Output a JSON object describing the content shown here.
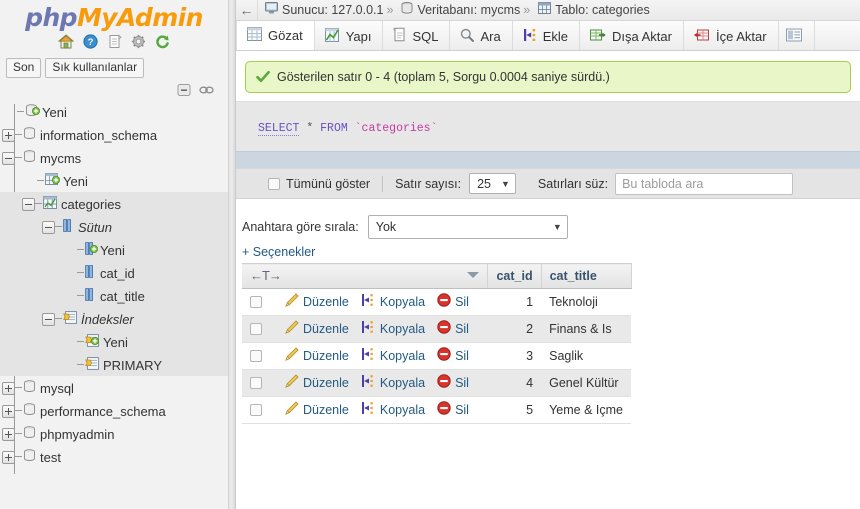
{
  "brand": {
    "php": "php",
    "myadmin": "MyAdmin"
  },
  "nav_icons": [
    {
      "name": "home-icon",
      "title": "Ana Sayfa"
    },
    {
      "name": "help-icon",
      "title": "Yardım"
    },
    {
      "name": "docs-icon",
      "title": "Belgeler"
    },
    {
      "name": "settings-gear-icon",
      "title": "Ayarlar"
    },
    {
      "name": "reload-icon",
      "title": "Yenile"
    }
  ],
  "nav_tabs": [
    {
      "label": "Son",
      "active": false
    },
    {
      "label": "Sık kullanılanlar",
      "active": false
    }
  ],
  "nav_collapse": [
    {
      "name": "collapse-all-icon"
    },
    {
      "name": "link-with-main-panel-icon"
    }
  ],
  "tree": [
    {
      "label": "Yeni",
      "depth": 1,
      "toggle": "none",
      "icon": "db-new-icon",
      "italic": false,
      "highlight": false
    },
    {
      "label": "information_schema",
      "depth": 1,
      "toggle": "plus",
      "icon": "db-icon",
      "italic": false,
      "highlight": false
    },
    {
      "label": "mycms",
      "depth": 1,
      "toggle": "minus",
      "icon": "db-icon",
      "italic": false,
      "highlight": false
    },
    {
      "label": "Yeni",
      "depth": 2,
      "toggle": "none",
      "icon": "table-new-icon",
      "italic": false,
      "highlight": false
    },
    {
      "label": "categories",
      "depth": 2,
      "toggle": "minus",
      "icon": "table-icon",
      "italic": false,
      "highlight": true
    },
    {
      "label": "Sütun",
      "depth": 3,
      "toggle": "minus",
      "icon": "columns-icon",
      "italic": true,
      "highlight": true
    },
    {
      "label": "Yeni",
      "depth": 4,
      "toggle": "none",
      "icon": "column-new-icon",
      "italic": false,
      "highlight": true
    },
    {
      "label": "cat_id",
      "depth": 4,
      "toggle": "none",
      "icon": "column-icon",
      "italic": false,
      "highlight": true
    },
    {
      "label": "cat_title",
      "depth": 4,
      "toggle": "none",
      "icon": "column-icon",
      "italic": false,
      "highlight": true
    },
    {
      "label": "İndeksler",
      "depth": 3,
      "toggle": "minus",
      "icon": "indexes-icon",
      "italic": true,
      "highlight": true
    },
    {
      "label": "Yeni",
      "depth": 4,
      "toggle": "none",
      "icon": "index-new-icon",
      "italic": false,
      "highlight": true
    },
    {
      "label": "PRIMARY",
      "depth": 4,
      "toggle": "none",
      "icon": "index-icon",
      "italic": false,
      "highlight": true
    },
    {
      "label": "mysql",
      "depth": 1,
      "toggle": "plus",
      "icon": "db-icon",
      "italic": false,
      "highlight": false
    },
    {
      "label": "performance_schema",
      "depth": 1,
      "toggle": "plus",
      "icon": "db-icon",
      "italic": false,
      "highlight": false
    },
    {
      "label": "phpmyadmin",
      "depth": 1,
      "toggle": "plus",
      "icon": "db-icon",
      "italic": false,
      "highlight": false
    },
    {
      "label": "test",
      "depth": 1,
      "toggle": "plus",
      "icon": "db-icon",
      "italic": false,
      "highlight": false
    }
  ],
  "breadcrumb": {
    "back_glyph": "←",
    "separator": "»",
    "segments": [
      {
        "label": "Sunucu: 127.0.0.1",
        "icon": "server-icon"
      },
      {
        "label": "Veritabanı: mycms",
        "icon": "database-icon"
      },
      {
        "label": "Tablo: categories",
        "icon": "table-icon"
      }
    ]
  },
  "tabs": [
    {
      "label": "Gözat",
      "icon": "browse-icon",
      "active": true
    },
    {
      "label": "Yapı",
      "icon": "structure-icon",
      "active": false
    },
    {
      "label": "SQL",
      "icon": "sql-icon",
      "active": false
    },
    {
      "label": "Ara",
      "icon": "search-icon",
      "active": false
    },
    {
      "label": "Ekle",
      "icon": "insert-icon",
      "active": false
    },
    {
      "label": "Dışa Aktar",
      "icon": "export-icon",
      "active": false
    },
    {
      "label": "İçe Aktar",
      "icon": "import-icon",
      "active": false
    },
    {
      "label": "",
      "icon": "privileges-icon",
      "active": false
    }
  ],
  "success": {
    "icon": "checkmark-icon",
    "message": "Gösterilen satır 0 - 4 (toplam 5, Sorgu 0.0004 saniye sürdü.)"
  },
  "sql": {
    "keyword_select": "SELECT",
    "star": "*",
    "keyword_from": "FROM",
    "identifier": "`categories`"
  },
  "options_row": {
    "show_all_label": "Tümünü göster",
    "row_count_label": "Satır sayısı:",
    "row_count_value": "25",
    "filter_label": "Satırları süz:",
    "filter_placeholder": "Bu tabloda ara",
    "filter_value": ""
  },
  "sort_row": {
    "label": "Anahtara göre sırala:",
    "value": "Yok"
  },
  "options_link": "+ Seçenekler",
  "table": {
    "action_header_arrows": "←T→",
    "columns": [
      "cat_id",
      "cat_title"
    ],
    "action_labels": {
      "edit": "Düzenle",
      "copy": "Kopyala",
      "delete": "Sil"
    },
    "rows": [
      {
        "cat_id": "1",
        "cat_title": "Teknoloji"
      },
      {
        "cat_id": "2",
        "cat_title": "Finans & Is"
      },
      {
        "cat_id": "3",
        "cat_title": "Saglik"
      },
      {
        "cat_id": "4",
        "cat_title": "Genel Kültür"
      },
      {
        "cat_id": "5",
        "cat_title": "Yeme & Içme"
      }
    ]
  },
  "colors": {
    "brand_php": "#6c78af",
    "brand_myadmin": "#f89c0e",
    "success_bg": "#e8f6c8",
    "success_border": "#a2d046",
    "link": "#235a81",
    "header_text": "#39526b",
    "sql_keyword": "#6a52c0",
    "sql_identifier": "#c53ba0"
  }
}
